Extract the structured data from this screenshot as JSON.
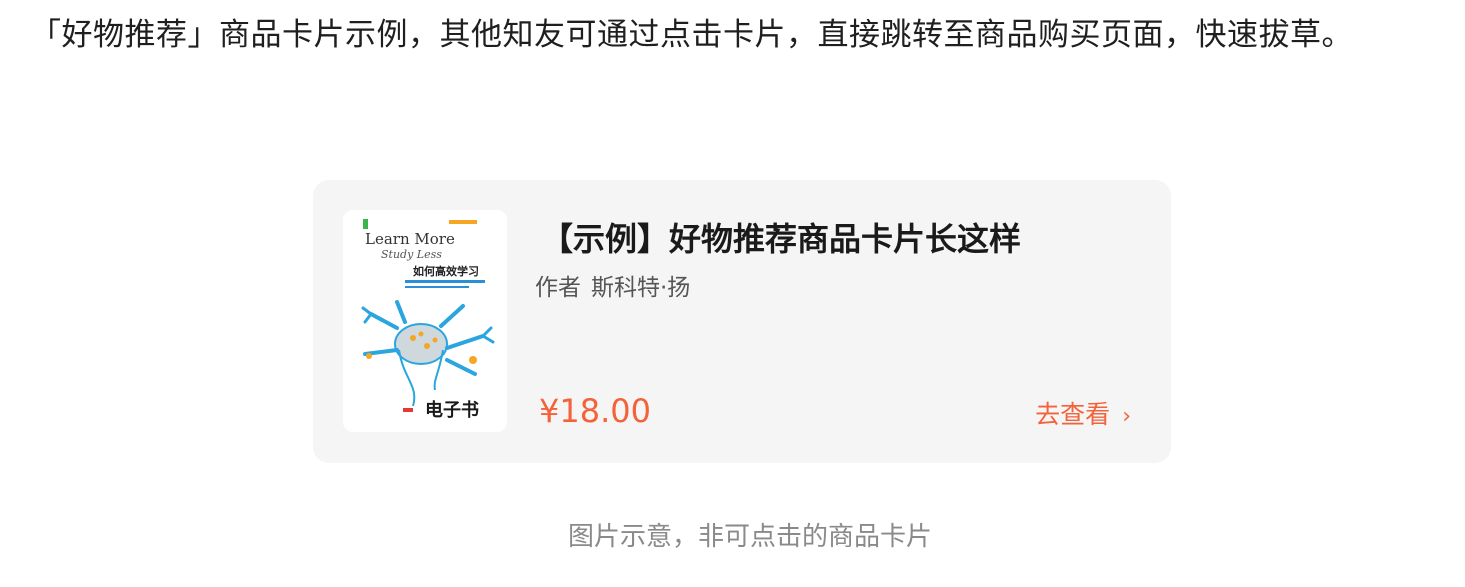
{
  "intro_text": "「好物推荐」商品卡片示例，其他知友可通过点击卡片，直接跳转至商品购买页面，快速拔草。",
  "card": {
    "cover": {
      "title_line1": "Learn More",
      "title_line2": "Study Less",
      "cn_title": "如何高效学习",
      "badge": "电子书"
    },
    "title": "【示例】好物推荐商品卡片长这样",
    "author_label": "作者",
    "author_name": "斯科特·扬",
    "price": "¥18.00",
    "view_label": "去查看",
    "chevron": "›"
  },
  "caption": "图片示意，非可点击的商品卡片",
  "colors": {
    "accent": "#f4623a",
    "card_bg": "#f5f5f5",
    "caption": "#8a8a8a"
  }
}
